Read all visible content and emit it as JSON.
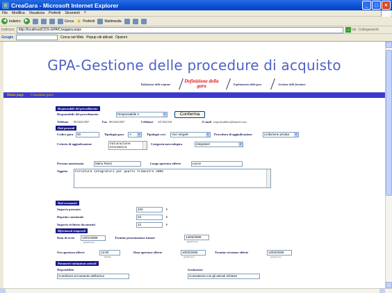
{
  "window": {
    "title": "CreaGara - Microsoft Internet Explorer"
  },
  "menu": [
    "File",
    "Modifica",
    "Visualizza",
    "Preferiti",
    "Strumenti",
    "?"
  ],
  "toolbar": {
    "back": "Indietro",
    "search": "Cerca",
    "favorites": "Preferiti",
    "multimedia": "Multimedia"
  },
  "address": {
    "label": "Indirizzo",
    "url": "http://localhost/CDS-GPA/Creagara.aspx",
    "go": "Vai",
    "links": "Collegamenti"
  },
  "googlebar": {
    "logo": "Google",
    "search_web": "Cerca nel Web",
    "popup": "Popup siti attivati",
    "options": "Opzioni"
  },
  "app": {
    "title": "GPA-Gestione delle procedure di acquisto",
    "steps": [
      "Definizione delle esigenze",
      "Definizione della gara",
      "Espletamento della gara",
      "Gestione delle forniture"
    ],
    "nav": {
      "home": "Home page",
      "current": "Creazione gara"
    }
  },
  "responsabile": {
    "section": "Responsabile del procedimento",
    "label": "Responsabile del procedimento",
    "selected": "Responsabile 2",
    "confirm": "Conferma",
    "telefono_label": "Telefono",
    "telefono": "0834423587",
    "fax_label": "Fax",
    "fax": "0834423587",
    "cellulare_label": "Cellulare",
    "cellulare": "347442334",
    "email_label": "E-mail",
    "email": "responsabile2@email.com"
  },
  "generali": {
    "section": "Dati generali",
    "codice_label": "Codice gara",
    "codice": "50",
    "tipologia_label": "Tipologia gara",
    "tipologia": "A",
    "tipologia_voci_label": "Tipologia voci",
    "tipologia_voci": "Voci singole",
    "procedura_label": "Procedura di aggiudicazione",
    "procedura": "Licitazione privata",
    "criterio_label": "Criterio di aggiudicazione",
    "criterio": "Valutazione economica",
    "categoria_label": "Categoria merceologica",
    "categoria": "integratori",
    "persona_label": "Persona autorizzata",
    "persona": "Mario Rossi",
    "luogo_label": "Luogo apertura offerte",
    "luogo": "Lecce",
    "oggetto_label": "Oggetto",
    "oggetto": "Fornitura integratori per quarto trimestre 2005"
  },
  "economici": {
    "section": "Dati economici",
    "importo_label": "Importo presunto",
    "importo": "234",
    "deposito_label": "Deposito cauzionale",
    "deposito": "23",
    "documenti_label": "Importo richiesto documenti",
    "documenti": "12",
    "currency": "€"
  },
  "temporali": {
    "section": "Riferimenti temporali",
    "data_avvio_label": "Data di avvio",
    "data_avvio": "12/01/2005",
    "termine_prev_label": "Termine presentazione istanze",
    "termine_prev": "14/02/2005",
    "ora_label": "Ora apertura offerte",
    "ora": "12:00",
    "data_apertura_label": "Data apertura offerte",
    "data_apertura": "10/02/2005",
    "termine_ricezione_label": "Termine ricezione offerte",
    "termine_ricezione": "12/04/2005",
    "hint_date": "(gg/mm/aaaa)",
    "hint_ora": "(hh:mm)"
  },
  "parametri": {
    "section": "Parametri valutazione articoli",
    "disponibilita_label": "Disponibilità",
    "disponibilita": "Condizioni al momento dell'arrivo",
    "sostituzioni_label": "Sostituzioni",
    "sostituzioni": "Consulenza con gli articoli richiesti"
  }
}
